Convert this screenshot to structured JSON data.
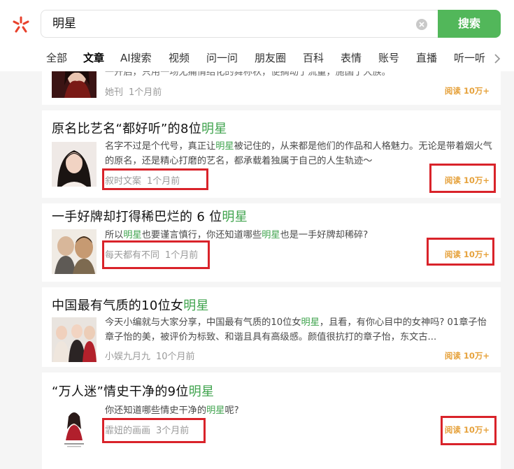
{
  "search": {
    "query": "明星",
    "button_label": "搜索"
  },
  "tabs": [
    "全部",
    "文章",
    "AI搜索",
    "视频",
    "问一问",
    "朋友圈",
    "百科",
    "表情",
    "账号",
    "直播",
    "听一听"
  ],
  "active_tab": "文章",
  "highlight_keyword": "明星",
  "colors": {
    "brand_green": "#52b75a",
    "highlight_green": "#3fa34d",
    "reads_orange": "#e6a23c",
    "annotation_red": "#d9232a"
  },
  "results": [
    {
      "title_before": "",
      "title_keyword": "",
      "title_after": "",
      "snippet": "一开启，只用一场无痛情结化的舞称秋，便摘动了流量，施国了大族。",
      "source": "她刊",
      "time": "1个月前",
      "reads": "阅读 10万+"
    },
    {
      "title_before": "原名比艺名“都好听”的8位",
      "title_keyword": "明星",
      "title_after": "",
      "snippet_before": "名字不过是个代号，真正让",
      "snippet_keyword": "明星",
      "snippet_after": "被记住的，从来都是他们的作品和人格魅力。无论是带着烟火气的原名，还是精心打磨的艺名，都承载着独属于自己的人生轨迹～",
      "source": "叙时文案",
      "time": "1个月前",
      "reads": "阅读 10万+"
    },
    {
      "title_before": "一手好牌却打得稀巴烂的 6 位",
      "title_keyword": "明星",
      "title_after": "",
      "snippet_parts": [
        "所以",
        "明星",
        "也要谨言慎行，你还知道哪些",
        "明星",
        "也是一手好牌却稀碎?"
      ],
      "source": "每天都有不同",
      "time": "1个月前",
      "reads": "阅读 10万+"
    },
    {
      "title_before": "中国最有气质的10位女",
      "title_keyword": "明星",
      "title_after": "",
      "snippet_before": "今天小编就与大家分享，中国最有气质的10位女",
      "snippet_keyword": "明星",
      "snippet_after": "，且看，有你心目中的女神吗? 01章子怡 章子怡的美，被评价为标致、和谐且具有高级感。颜值很抗打的章子怡，东文古...",
      "source": "小娱九月九",
      "time": "10个月前",
      "reads": "阅读 10万+"
    },
    {
      "title_before": "“万人迷”情史干净的9位",
      "title_keyword": "明星",
      "title_after": "",
      "snippet_before": "你还知道哪些情史干净的",
      "snippet_keyword": "明星",
      "snippet_after": "呢?",
      "source": "霏妞的画画",
      "time": "3个月前",
      "reads": "阅读 10万+"
    }
  ]
}
